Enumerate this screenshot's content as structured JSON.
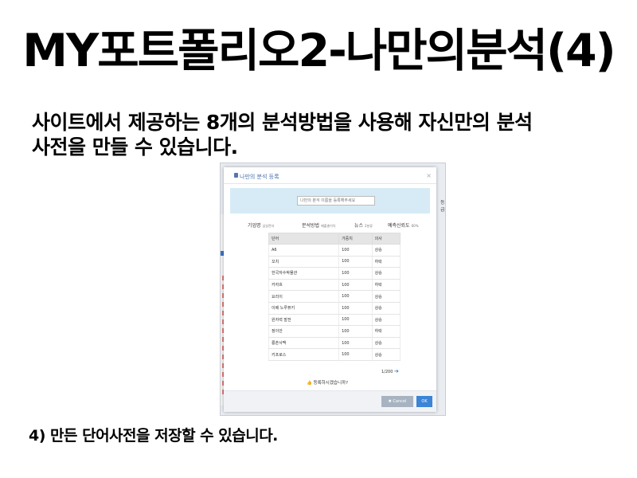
{
  "slide": {
    "title": "MY포트폴리오2-나만의분석(4)",
    "desc_line1": "사이트에서 제공하는 8개의 분석방법을 사용해 자신만의 분석",
    "desc_line2": "사전을 만들 수 있습니다.",
    "footer": "4) 만든 단어사전을 저장할 수 있습니다."
  },
  "background": {
    "side_label": "등급",
    "left_tab": "1",
    "left_badge": "5"
  },
  "dialog": {
    "title": "나만의 분석 등록",
    "close": "×",
    "name_placeholder": "나만의 분석 이름을 등록해주세요",
    "filters": [
      {
        "label": "기업명",
        "sub": "삼성전자"
      },
      {
        "label": "분석방법",
        "sub": "매출총이익"
      },
      {
        "label": "뉴스",
        "sub": "2분류"
      },
      {
        "label": "예측신뢰도",
        "sub": "60%"
      }
    ],
    "table": {
      "headers": [
        "단어",
        "가중치",
        "의사"
      ],
      "rows": [
        [
          "A6",
          "100",
          "상승"
        ],
        [
          "꼬치",
          "100",
          "하락"
        ],
        [
          "한국자수박물관",
          "100",
          "상승"
        ],
        [
          "카자흐",
          "100",
          "하락"
        ],
        [
          "요리이",
          "100",
          "상승"
        ],
        [
          "이베 노루퓨키",
          "100",
          "상승"
        ],
        [
          "원자력 발전",
          "100",
          "상승"
        ],
        [
          "정이안",
          "100",
          "하락"
        ],
        [
          "룡촌사맥",
          "100",
          "상승"
        ],
        [
          "키프로스",
          "100",
          "상승"
        ]
      ]
    },
    "pager": "1/200",
    "pager_arrow": "➔",
    "confirm_icon": "👍",
    "confirm": "등록하시겠습니까?",
    "cancel_icon": "✖",
    "cancel_label": "Cancel",
    "ok_label": "OK"
  }
}
